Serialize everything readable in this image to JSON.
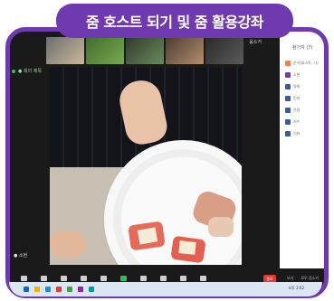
{
  "banner": {
    "title": "줌 호스트 되기 및 줌 활용강좌"
  },
  "zoom": {
    "status_text": "● 회의 제목",
    "mute_label": "음소거",
    "participant_name": "● 소현",
    "thumb_names": [
      "",
      "",
      "",
      "",
      "준식"
    ]
  },
  "toolbar": {
    "items": [
      {
        "label": "오디오 끄기",
        "icon": "mic-icon"
      },
      {
        "label": "비디오 중지",
        "icon": "video-icon"
      },
      {
        "label": "보안",
        "icon": "shield-icon"
      },
      {
        "label": "참가자",
        "icon": "people-icon"
      },
      {
        "label": "채팅",
        "icon": "chat-icon"
      },
      {
        "label": "화면 공유",
        "icon": "share-screen-icon",
        "accent": true
      },
      {
        "label": "기록",
        "icon": "record-icon"
      },
      {
        "label": "소회의실",
        "icon": "breakout-icon"
      },
      {
        "label": "반응",
        "icon": "reaction-icon"
      },
      {
        "label": "더 보기",
        "icon": "more-icon"
      }
    ],
    "end_label": "종료",
    "right": [
      "보기",
      "모두 음소거"
    ]
  },
  "panel": {
    "title": "참가자 (7)",
    "items": [
      {
        "label": "준식(호스트, 나)",
        "color": "#ff7a45"
      },
      {
        "label": "소현",
        "color": "#6f39b0"
      },
      {
        "label": "영희",
        "color": "#3b5b9b"
      },
      {
        "label": "민지",
        "color": "#3b5b9b"
      },
      {
        "label": "은정",
        "color": "#3b5b9b"
      },
      {
        "label": "지수",
        "color": "#3b5b9b"
      },
      {
        "label": "기타",
        "color": "#3b5b9b"
      }
    ]
  },
  "taskbar": {
    "clock": "오후 3:02",
    "icon_colors": [
      "#1565c0",
      "#f6b400",
      "#1e88e5",
      "#e53935",
      "#43a047",
      "#8e24aa",
      "#0097a7"
    ]
  },
  "colors": {
    "accent": "#6f39b0",
    "end": "#e53935",
    "green": "#2fbf5b"
  }
}
